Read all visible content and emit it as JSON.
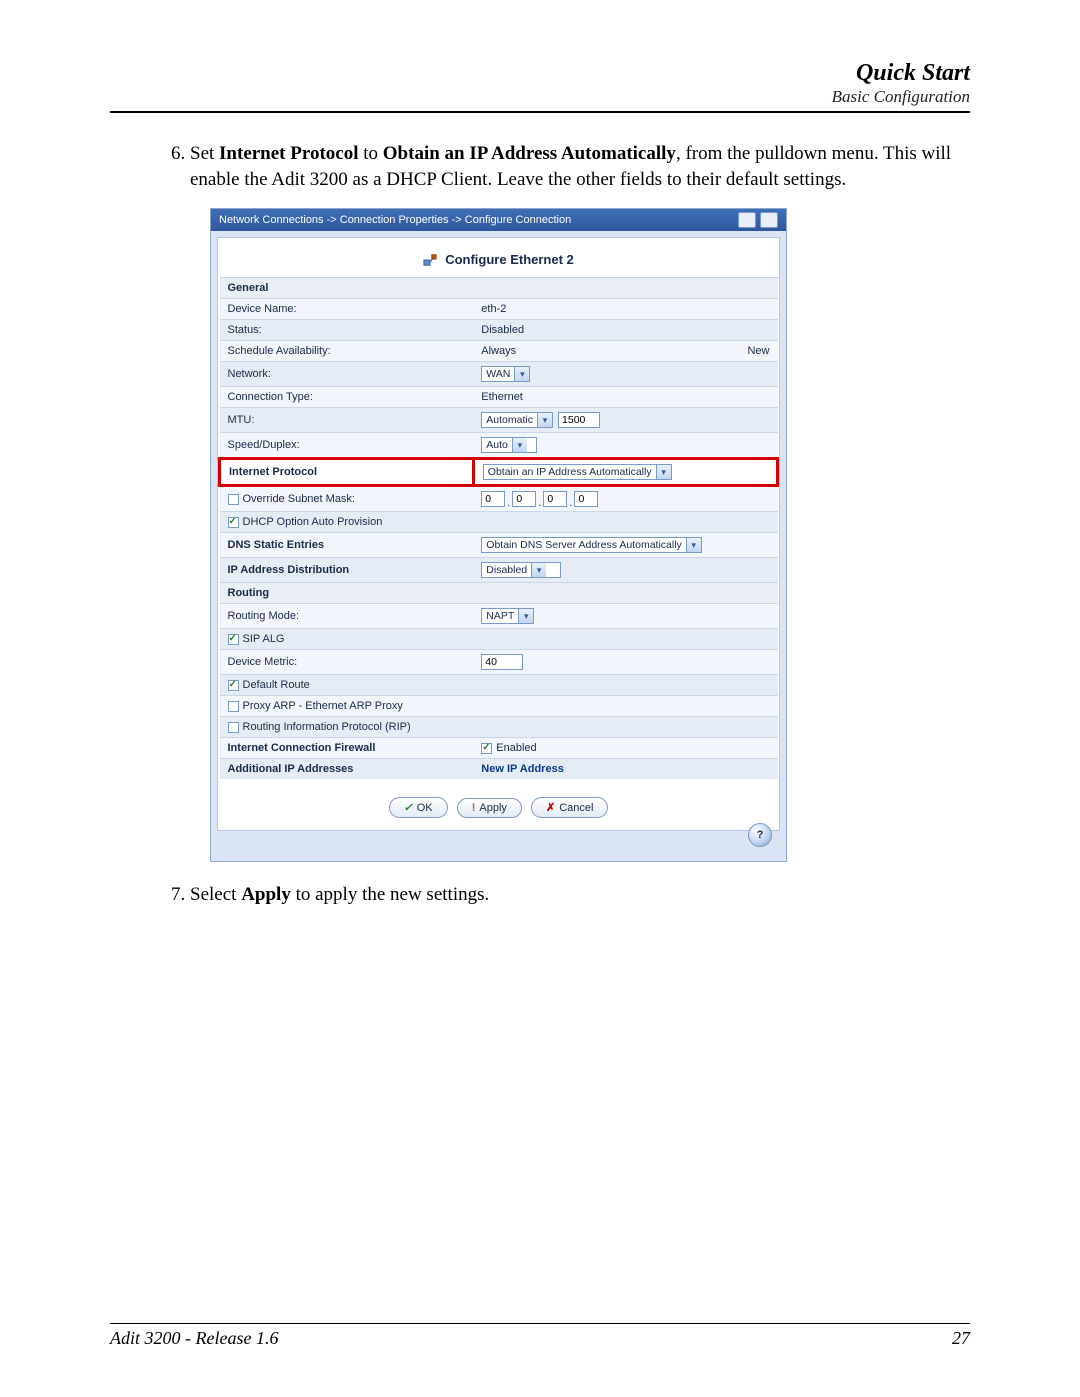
{
  "running_head": {
    "title": "Quick Start",
    "subtitle": "Basic Configuration"
  },
  "step6": {
    "number": "6.",
    "pre": "Set ",
    "bold1": "Internet Protocol",
    "mid": " to ",
    "bold2": "Obtain an IP Address Automatically",
    "post": ", from the pulldown menu. This will enable the Adit 3200 as a DHCP Client. Leave the other fields to their default settings."
  },
  "breadcrumb": "Network Connections -> Connection Properties -> Configure Connection",
  "card_title": "Configure Ethernet 2",
  "sections": {
    "general": {
      "heading": "General",
      "device_name": {
        "label": "Device Name:",
        "value": "eth-2"
      },
      "status": {
        "label": "Status:",
        "value": "Disabled"
      },
      "schedule": {
        "label": "Schedule Availability:",
        "value": "Always",
        "link": "New"
      },
      "network": {
        "label": "Network:",
        "value": "WAN"
      },
      "conn_type": {
        "label": "Connection Type:",
        "value": "Ethernet"
      },
      "mtu": {
        "label": "MTU:",
        "mode": "Automatic",
        "value": "1500"
      },
      "speed": {
        "label": "Speed/Duplex:",
        "value": "Auto"
      }
    },
    "ip": {
      "internet_protocol": {
        "label": "Internet Protocol",
        "value": "Obtain an IP Address Automatically"
      },
      "override_subnet": {
        "label": "Override Subnet Mask:",
        "oct": [
          "0",
          "0",
          "0",
          "0"
        ]
      },
      "dhcp_auto_prov": {
        "label": "DHCP Option Auto Provision"
      },
      "dns_static": {
        "label": "DNS Static Entries",
        "value": "Obtain DNS Server Address Automatically"
      },
      "ip_dist": {
        "label": "IP Address Distribution",
        "value": "Disabled"
      }
    },
    "routing": {
      "heading": "Routing",
      "mode": {
        "label": "Routing Mode:",
        "value": "NAPT"
      },
      "sip_alg": {
        "label": "SIP ALG"
      },
      "metric": {
        "label": "Device Metric:",
        "value": "40"
      },
      "default_route": {
        "label": "Default Route"
      },
      "proxy_arp": {
        "label": "Proxy ARP - Ethernet ARP Proxy"
      },
      "rip": {
        "label": "Routing Information Protocol (RIP)"
      }
    },
    "firewall": {
      "label": "Internet Connection Firewall",
      "value": "Enabled"
    },
    "addl_ips": {
      "label": "Additional IP Addresses",
      "value": "New IP Address"
    }
  },
  "buttons": {
    "ok": "OK",
    "apply": "Apply",
    "cancel": "Cancel"
  },
  "help": "?",
  "step7": {
    "number": "7.",
    "pre": "Select ",
    "bold": "Apply",
    "post": " to apply the new settings."
  },
  "footer": {
    "left": "Adit 3200  - Release 1.6",
    "right": "27"
  }
}
